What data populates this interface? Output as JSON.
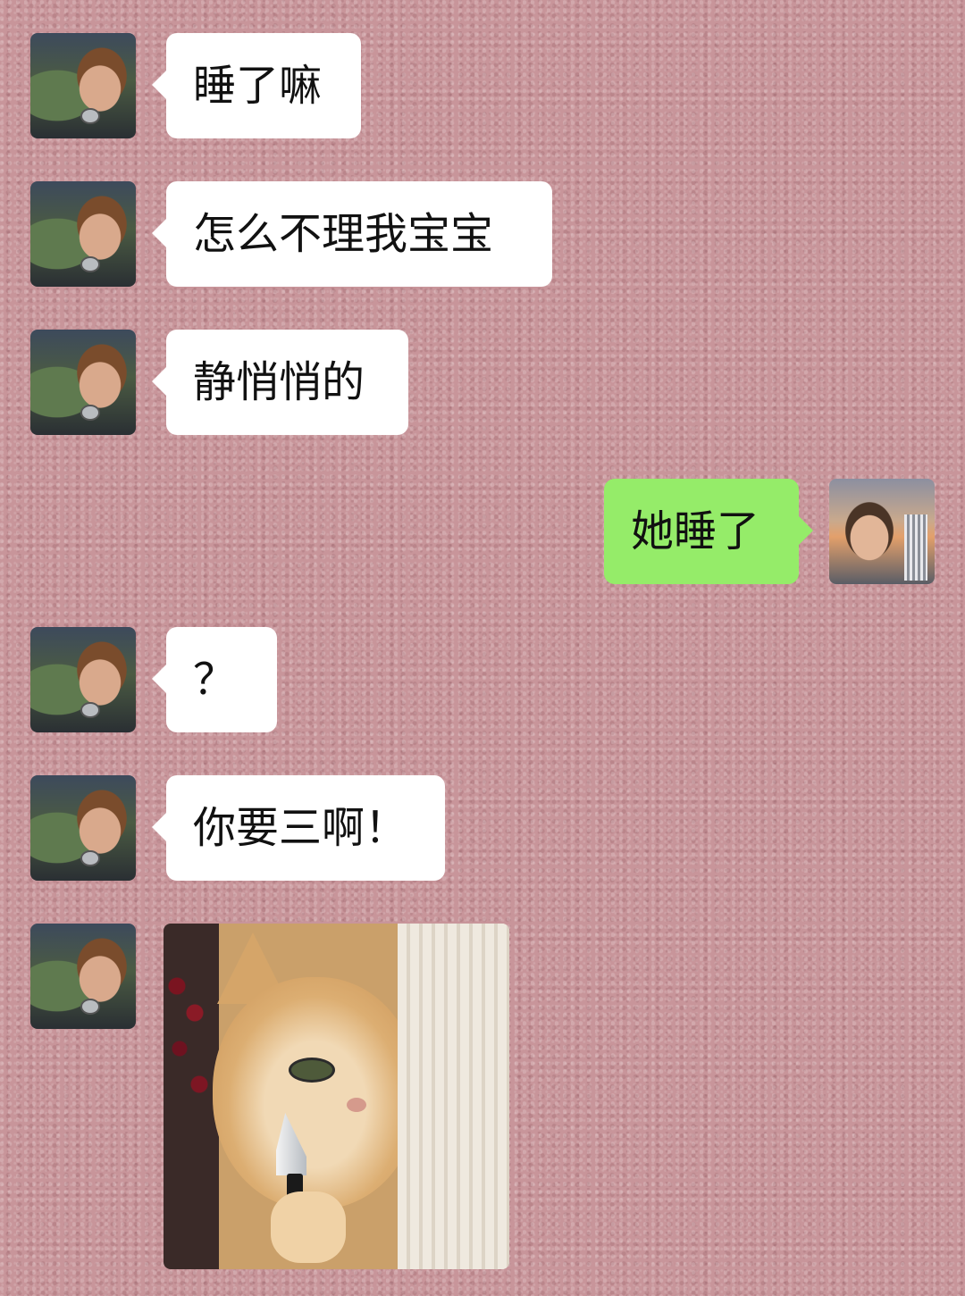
{
  "chat": {
    "messages": [
      {
        "sender": "contact",
        "type": "text",
        "text": "睡了嘛"
      },
      {
        "sender": "contact",
        "type": "text",
        "text": "怎么不理我宝宝"
      },
      {
        "sender": "contact",
        "type": "text",
        "text": "静悄悄的"
      },
      {
        "sender": "me",
        "type": "text",
        "text": "她睡了"
      },
      {
        "sender": "contact",
        "type": "text",
        "text": "？"
      },
      {
        "sender": "contact",
        "type": "text",
        "text": "你要三啊！"
      },
      {
        "sender": "contact",
        "type": "sticker",
        "sticker": "cat-holding-knife-sticker"
      }
    ]
  },
  "colors": {
    "background": "#c8959a",
    "incoming_bubble": "#ffffff",
    "outgoing_bubble": "#95ec69"
  }
}
